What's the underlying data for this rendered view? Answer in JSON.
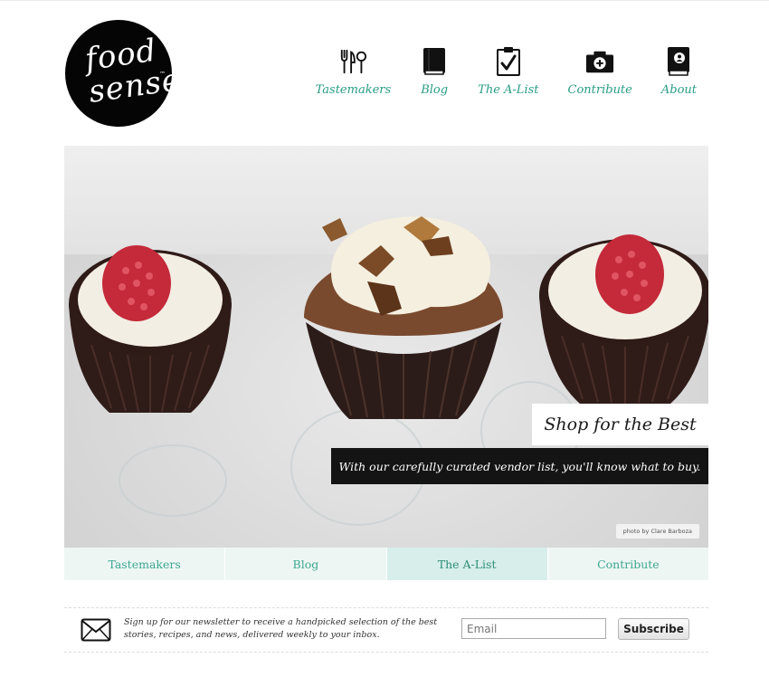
{
  "brand": {
    "line1": "food",
    "line2": "sense",
    "tm": "™"
  },
  "nav": [
    {
      "label": "Tastemakers",
      "icon": "utensils-icon"
    },
    {
      "label": "Blog",
      "icon": "book-icon"
    },
    {
      "label": "The A-List",
      "icon": "clipboard-check-icon"
    },
    {
      "label": "Contribute",
      "icon": "camera-plus-icon"
    },
    {
      "label": "About",
      "icon": "address-book-icon"
    }
  ],
  "hero": {
    "title": "Shop for the Best",
    "subtitle": "With our carefully curated vendor list, you'll know what to buy.",
    "credit": "photo by Clare Barboza"
  },
  "subtabs": [
    {
      "label": "Tastemakers",
      "active": false
    },
    {
      "label": "Blog",
      "active": false
    },
    {
      "label": "The A-List",
      "active": true
    },
    {
      "label": "Contribute",
      "active": false
    }
  ],
  "newsletter": {
    "text": "Sign up for our newsletter to receive a handpicked selection of the best stories, recipes, and news, delivered weekly to your inbox.",
    "placeholder": "Email",
    "button": "Subscribe"
  },
  "colors": {
    "accent": "#2a9d85",
    "tab_bg": "#eef6f4",
    "tab_active": "#d7eeea"
  }
}
